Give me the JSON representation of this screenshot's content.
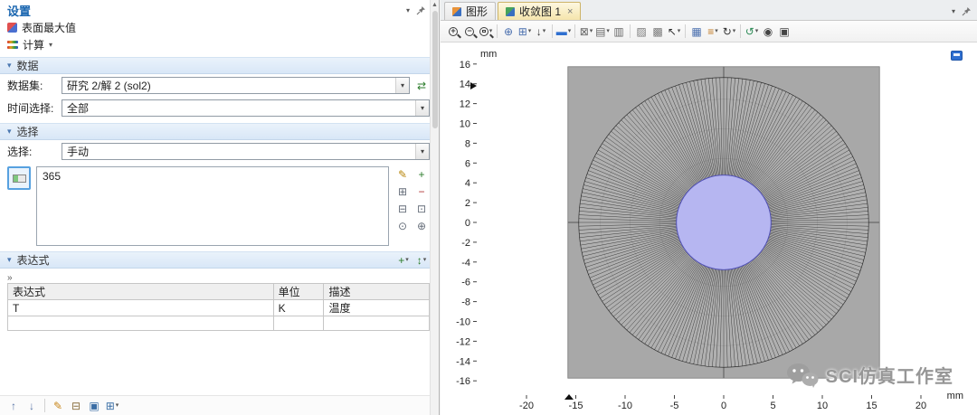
{
  "glyphs": {
    "caret": "▾",
    "close": "×",
    "section_collapse": "▾",
    "scroll_up": "▲",
    "table_marker": "»"
  },
  "settings": {
    "title": "设置",
    "node": {
      "label": "表面最大值"
    },
    "compute": {
      "label": "计算"
    },
    "sections": {
      "data": {
        "title": "数据",
        "dataset_label": "数据集:",
        "dataset_value": "研究 2/解 2 (sol2)",
        "time_label": "时间选择:",
        "time_value": "全部"
      },
      "selection": {
        "title": "选择",
        "label": "选择:",
        "value": "手动",
        "items": [
          "365"
        ]
      },
      "expression": {
        "title": "表达式",
        "headers": [
          "表达式",
          "单位",
          "描述"
        ],
        "rows": [
          [
            "T",
            "K",
            "温度"
          ],
          [
            "",
            "",
            ""
          ]
        ]
      }
    },
    "dataset_tools": [
      {
        "name": "switch-solution-icon",
        "glyph": "⇄",
        "color": "#2d7d2d"
      }
    ],
    "selection_tools_left": [
      {
        "name": "create-selection-icon",
        "glyph": "✎",
        "color": "#b8860b"
      },
      {
        "name": "copy-selection-icon",
        "glyph": "⊞",
        "color": "#666e7a"
      },
      {
        "name": "paste-selection-icon",
        "glyph": "⊟",
        "color": "#666e7a"
      },
      {
        "name": "zoom-to-selection-icon",
        "glyph": "⊙",
        "color": "#666e7a"
      }
    ],
    "selection_tools_right": [
      {
        "name": "add-to-selection-icon",
        "glyph": "+",
        "color": "#2d7d2d"
      },
      {
        "name": "remove-from-selection-icon",
        "glyph": "−",
        "color": "#b03030"
      },
      {
        "name": "clear-selection-icon",
        "glyph": "⊡",
        "color": "#666e7a"
      },
      {
        "name": "center-selection-icon",
        "glyph": "⊕",
        "color": "#666e7a"
      }
    ],
    "expression_tools": [
      {
        "name": "add-expression-icon",
        "glyph": "+",
        "color": "#2d7d2d",
        "caret": true
      },
      {
        "name": "replace-expression-icon",
        "glyph": "↕",
        "color": "#2d7d2d",
        "caret": true
      }
    ],
    "bottom_tools": [
      {
        "name": "move-up-icon",
        "glyph": "↑",
        "color": "#5a76a8"
      },
      {
        "name": "move-down-icon",
        "glyph": "↓",
        "color": "#5a76a8"
      },
      {
        "sep": true
      },
      {
        "name": "edit-expression-icon",
        "glyph": "✎",
        "color": "#c8861a"
      },
      {
        "name": "load-from-file-icon",
        "glyph": "⊟",
        "color": "#8a7040"
      },
      {
        "name": "save-to-file-icon",
        "glyph": "▣",
        "color": "#3a6ea5"
      },
      {
        "name": "table-settings-icon",
        "glyph": "⊞",
        "color": "#3a6ea5",
        "caret": true
      }
    ]
  },
  "graphics": {
    "tabs": [
      {
        "label": "图形"
      },
      {
        "label": "收敛图 1"
      }
    ],
    "toolbar": [
      {
        "name": "zoom-in-icon",
        "mag": "+"
      },
      {
        "name": "zoom-out-icon",
        "mag": "−"
      },
      {
        "name": "zoom-box-icon",
        "mag": "box",
        "caret": true
      },
      {
        "sep": true
      },
      {
        "name": "zoom-extents-icon",
        "glyph": "⊕",
        "color": "#4a6fae"
      },
      {
        "name": "go-to-default-view-icon",
        "glyph": "⊞",
        "color": "#4a6fae",
        "caret": true
      },
      {
        "name": "view-down-icon",
        "glyph": "↓",
        "color": "#333333",
        "caret": true
      },
      {
        "sep": true
      },
      {
        "name": "scene-color-icon",
        "glyph": "▬",
        "color": "#2f6fd0",
        "caret": true
      },
      {
        "sep": true
      },
      {
        "name": "copy-image-icon",
        "glyph": "⊠",
        "color": "#666666",
        "caret": true
      },
      {
        "name": "export-image-icon",
        "glyph": "▤",
        "color": "#666666",
        "caret": true
      },
      {
        "name": "print-icon",
        "glyph": "▥",
        "color": "#666666"
      },
      {
        "sep": true
      },
      {
        "name": "transparency-icon",
        "glyph": "▨",
        "color": "#7a7a7a"
      },
      {
        "name": "wireframe-icon",
        "glyph": "▩",
        "color": "#7a7a7a"
      },
      {
        "name": "select-entities-icon",
        "glyph": "↖",
        "color": "#333333",
        "caret": true
      },
      {
        "sep": true
      },
      {
        "name": "grid-icon",
        "glyph": "▦",
        "color": "#4a6fae"
      },
      {
        "name": "legend-icon",
        "glyph": "≡",
        "color": "#c07820",
        "caret": true
      },
      {
        "name": "rotate-view-icon",
        "glyph": "↻",
        "color": "#333333",
        "caret": true
      },
      {
        "sep": true
      },
      {
        "name": "refresh-scene-icon",
        "glyph": "↺",
        "color": "#2e8b57",
        "caret": true
      },
      {
        "name": "camera-icon",
        "glyph": "◉",
        "color": "#444444"
      },
      {
        "name": "printer-icon",
        "glyph": "▣",
        "color": "#444444"
      }
    ],
    "plot": {
      "axis_unit": "mm",
      "x_ticks": [
        -20,
        -15,
        -10,
        -5,
        0,
        5,
        10,
        15,
        20
      ],
      "y_ticks": [
        16,
        14,
        12,
        10,
        8,
        6,
        4,
        2,
        0,
        -2,
        -4,
        -6,
        -8,
        -10,
        -12,
        -14,
        -16
      ],
      "watermark": "SCI仿真工作室",
      "geometry": {
        "square_half_mm": 15.8,
        "outer_radius_mm": 14.7,
        "inner_radius_mm": 4.8,
        "square_color": "#a8a8a8",
        "annulus_color": "#b0b0b0",
        "inner_color": "#b6b6f1",
        "inner_stroke": "#5151b5",
        "line_color": "#1c1c1c",
        "n_radial_lines": 240,
        "ring_radii_mm": [
          6.5,
          9.5,
          12.5
        ]
      }
    }
  }
}
